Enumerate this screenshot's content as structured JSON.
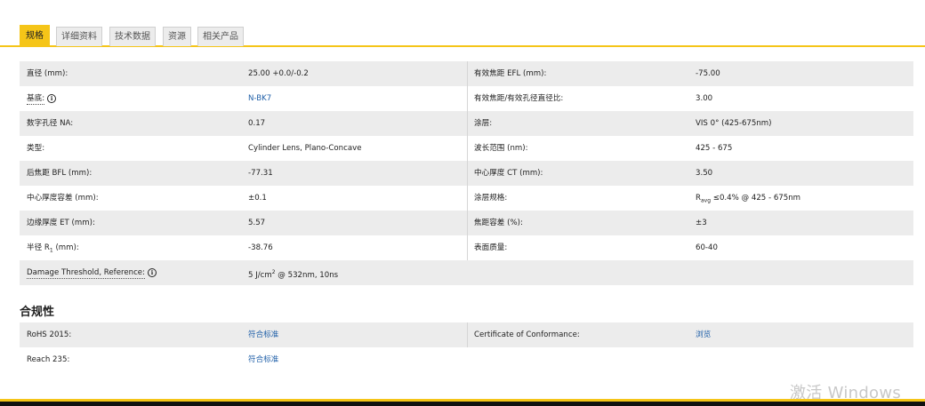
{
  "tabs": [
    {
      "label": "规格",
      "active": true
    },
    {
      "label": "详细资料",
      "active": false
    },
    {
      "label": "技术数据",
      "active": false
    },
    {
      "label": "资源",
      "active": false
    },
    {
      "label": "相关产品",
      "active": false
    }
  ],
  "specs": [
    {
      "l1": "直径 (mm):",
      "v1": "25.00 +0.0/-0.2",
      "l2": "有效焦距 EFL (mm):",
      "v2": "-75.00"
    },
    {
      "l1": "基底:",
      "v1": "N-BK7",
      "l2": "有效焦距/有效孔径直径比:",
      "v2": "3.00"
    },
    {
      "l1": "数字孔径 NA:",
      "v1": "0.17",
      "l2": "涂层:",
      "v2": "VIS 0° (425-675nm)"
    },
    {
      "l1": "类型:",
      "v1": "Cylinder Lens, Plano-Concave",
      "l2": "波长范围 (nm):",
      "v2": "425 - 675"
    },
    {
      "l1": "后焦距 BFL (mm):",
      "v1": "-77.31",
      "l2": "中心厚度 CT (mm):",
      "v2": "3.50"
    },
    {
      "l1": "中心厚度容差 (mm):",
      "v1": "±0.1",
      "l2": "涂层规格:",
      "v2_prefix": "R",
      "v2_sub": "avg",
      "v2": "≤0.4% @ 425 - 675nm"
    },
    {
      "l1": "边缘厚度 ET (mm):",
      "v1": "5.57",
      "l2": "焦距容差 (%):",
      "v2": "±3"
    },
    {
      "l1_prefix": "半径 R",
      "l1_sub": "1",
      "l1": " (mm):",
      "v1": "-38.76",
      "l2": "表面质量:",
      "v2": "60-40"
    },
    {
      "l1": "Damage Threshold, Reference:",
      "v1_prefix": "5 J/cm",
      "v1_sup": "2",
      "v1": " @ 532nm, 10ns"
    }
  ],
  "compliance": {
    "title": "合规性",
    "rows": [
      {
        "l1": "RoHS 2015:",
        "v1": "符合标准",
        "l2": "Certificate of Conformance:",
        "v2": "浏览"
      },
      {
        "l1": "Reach 235:",
        "v1": "符合标准"
      }
    ]
  },
  "watermark": "激活 Windows",
  "colors": {
    "accent": "#f5c518",
    "link": "#1f5fa8",
    "row_alt": "#ececec"
  }
}
